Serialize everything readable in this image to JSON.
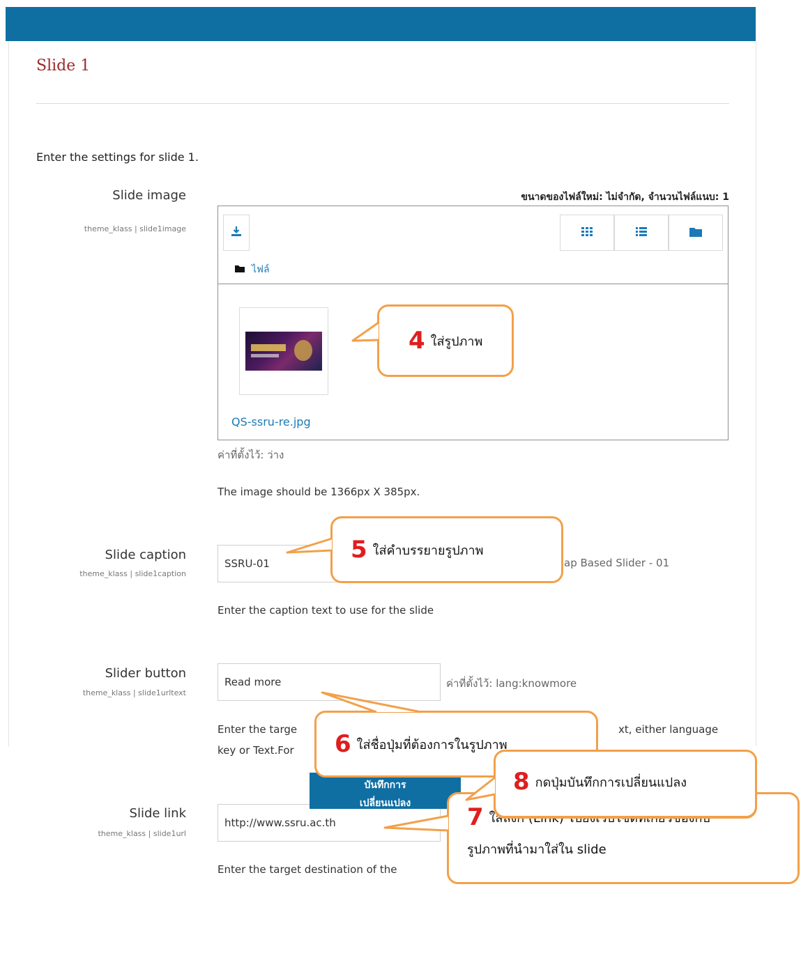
{
  "heading": "Slide 1",
  "intro": "Enter the settings for slide 1.",
  "slide_image": {
    "label": "Slide image",
    "setting": "theme_klass | slide1image",
    "limits": "ขนาดของไฟล์ใหม่: ไม่จำกัด, จำนวนไฟล์แนบ: 1",
    "folder": "ไฟล์",
    "filename": "QS-ssru-re.jpg",
    "default": "ค่าที่ตั้งไว้: ว่าง",
    "hint": "The image should be 1366px X 385px.",
    "icons": [
      "download-icon",
      "grid-view-icon",
      "list-view-icon",
      "folder-icon"
    ]
  },
  "slide_caption": {
    "label": "Slide caption",
    "setting": "theme_klass | slide1caption",
    "value": "SSRU-01",
    "default_partial": "ap Based Slider - 01",
    "hint": "Enter the caption text to use for the slide"
  },
  "slider_button": {
    "label": "Slider button",
    "setting": "theme_klass | slide1urltext",
    "value": "Read more",
    "default": "ค่าที่ตั้งไว้: lang:knowmore",
    "hint_left1": "Enter the targe",
    "hint_right1": "xt, either language",
    "hint_left2": "key or Text.For"
  },
  "slide_link": {
    "label": "Slide link",
    "setting": "theme_klass | slide1url",
    "value": "http://www.ssru.ac.th",
    "hint": "Enter the target destination of the"
  },
  "save_button": {
    "line1": "บันทึกการ",
    "line2": "เปลี่ยนแปลง"
  },
  "callouts": [
    {
      "num": "4",
      "text": "ใส่รูปภาพ"
    },
    {
      "num": "5",
      "text": "ใส่คำบรรยายรูปภาพ"
    },
    {
      "num": "6",
      "text": "ใส่ชื่อปุ่มที่ต้องการในรูปภาพ"
    },
    {
      "num": "7",
      "text": "ใส่ลิงก์ (Link) ไปยังเว็บไซต์ที่เกี่ยวข้องกับ",
      "text2": "รูปภาพที่นำมาใส่ใน slide"
    },
    {
      "num": "8",
      "text": "กดปุ่มบันทึกการเปลี่ยนแปลง"
    }
  ],
  "colors": {
    "header": "#0f6fa3",
    "heading": "#9c2a2a",
    "link": "#1a7ab8",
    "callout_border": "#f2a04a",
    "callout_number": "#e01e1e"
  }
}
